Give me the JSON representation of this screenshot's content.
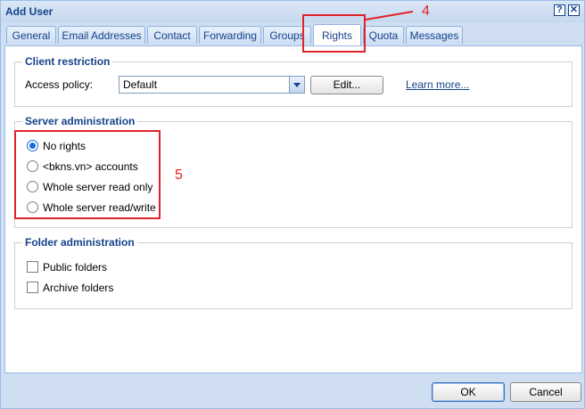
{
  "dialog": {
    "title": "Add User"
  },
  "titlebar_buttons": {
    "help": "?",
    "close": "✕"
  },
  "tabs": [
    {
      "label": "General"
    },
    {
      "label": "Email Addresses"
    },
    {
      "label": "Contact"
    },
    {
      "label": "Forwarding"
    },
    {
      "label": "Groups"
    },
    {
      "label": "Rights",
      "active": true
    },
    {
      "label": "Quota"
    },
    {
      "label": "Messages"
    }
  ],
  "client_restriction": {
    "legend": "Client restriction",
    "access_policy_label": "Access policy:",
    "access_policy_value": "Default",
    "edit_label": "Edit...",
    "learn_more": "Learn more..."
  },
  "server_admin": {
    "legend": "Server administration",
    "options": [
      {
        "label": "No rights",
        "selected": true
      },
      {
        "label": "<bkns.vn> accounts",
        "selected": false
      },
      {
        "label": "Whole server read only",
        "selected": false
      },
      {
        "label": "Whole server read/write",
        "selected": false
      }
    ]
  },
  "folder_admin": {
    "legend": "Folder administration",
    "options": [
      {
        "label": "Public folders",
        "checked": false
      },
      {
        "label": "Archive folders",
        "checked": false
      }
    ]
  },
  "footer": {
    "ok": "OK",
    "cancel": "Cancel"
  },
  "annotations": {
    "tab_marker": "4",
    "options_marker": "5",
    "color": "#e0232a"
  }
}
